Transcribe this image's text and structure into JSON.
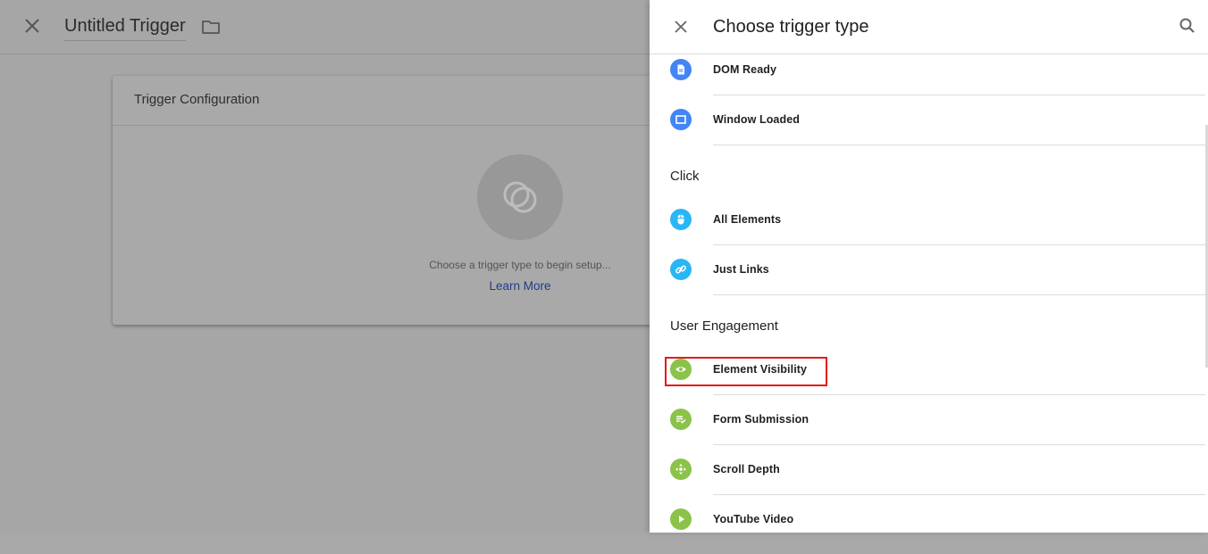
{
  "header": {
    "trigger_name": "Untitled Trigger"
  },
  "card": {
    "title": "Trigger Configuration",
    "choose_text": "Choose a trigger type to begin setup...",
    "learn_more": "Learn More"
  },
  "panel": {
    "title": "Choose trigger type",
    "items_top": [
      {
        "label": "DOM Ready",
        "icon": "document-icon"
      },
      {
        "label": "Window Loaded",
        "icon": "window-icon"
      }
    ],
    "sections": [
      {
        "heading": "Click",
        "items": [
          {
            "label": "All Elements",
            "icon": "mouse-icon"
          },
          {
            "label": "Just Links",
            "icon": "link-icon"
          }
        ]
      },
      {
        "heading": "User Engagement",
        "items": [
          {
            "label": "Element Visibility",
            "icon": "eye-icon"
          },
          {
            "label": "Form Submission",
            "icon": "form-icon"
          },
          {
            "label": "Scroll Depth",
            "icon": "scroll-icon"
          },
          {
            "label": "YouTube Video",
            "icon": "play-icon"
          }
        ]
      }
    ]
  },
  "colors": {
    "page_load_icon": "#4285f4",
    "click_icon": "#29b6f6",
    "engagement_icon": "#8bc34a",
    "highlight": "#e21b1b",
    "link": "#233a85"
  }
}
